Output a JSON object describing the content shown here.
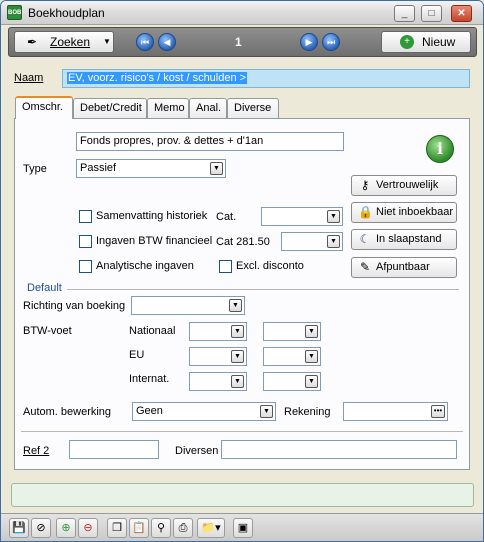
{
  "window": {
    "title": "Boekhoudplan",
    "icon": "app-logo-icon"
  },
  "toolbar": {
    "search_label": "Zoeken",
    "record_counter": "1",
    "new_label": "Nieuw"
  },
  "naam": {
    "label": "Naam",
    "value": "EV, voorz. risico's / kost / schulden >"
  },
  "tabs": [
    {
      "label": "Omschr."
    },
    {
      "label": "Debet/Credit"
    },
    {
      "label": "Memo"
    },
    {
      "label": "Anal."
    },
    {
      "label": "Diverse"
    }
  ],
  "panel": {
    "description_value": "Fonds propres, prov. & dettes + d'1an",
    "type_label": "Type",
    "type_value": "Passief",
    "checkboxes": {
      "history_summary": "Samenvatting historiek",
      "vat_financial": "Ingaven BTW financieel",
      "analytic": "Analytische ingaven",
      "excl_discount": "Excl. disconto"
    },
    "cat_label": "Cat.",
    "cat_value": "",
    "cat281_label": "Cat 281.50",
    "cat281_value": "",
    "buttons": {
      "confidential": "Vertrouwelijk",
      "not_bookable": "Niet inboekbaar",
      "sleep_mode": "In slaapstand",
      "reconcilable": "Afpuntbaar"
    },
    "default_label": "Default",
    "booking_direction_label": "Richting van boeking",
    "booking_direction_value": "",
    "vat_rate_label": "BTW-voet",
    "vat_rows": [
      {
        "label": "Nationaal"
      },
      {
        "label": "EU"
      },
      {
        "label": "Internat."
      }
    ],
    "auto_processing_label": "Autom. bewerking",
    "auto_processing_value": "Geen",
    "account_label": "Rekening",
    "account_value": "",
    "ref2_label": "Ref 2",
    "ref2_value": "",
    "misc_label": "Diversen",
    "misc_value": ""
  },
  "status": {
    "text": ""
  },
  "colors": {
    "selection": "#3399ff",
    "name_field_bg": "#bfe3f6",
    "toolbar_bg": "#7f7f7f",
    "status_bg": "#e8f3e8"
  }
}
